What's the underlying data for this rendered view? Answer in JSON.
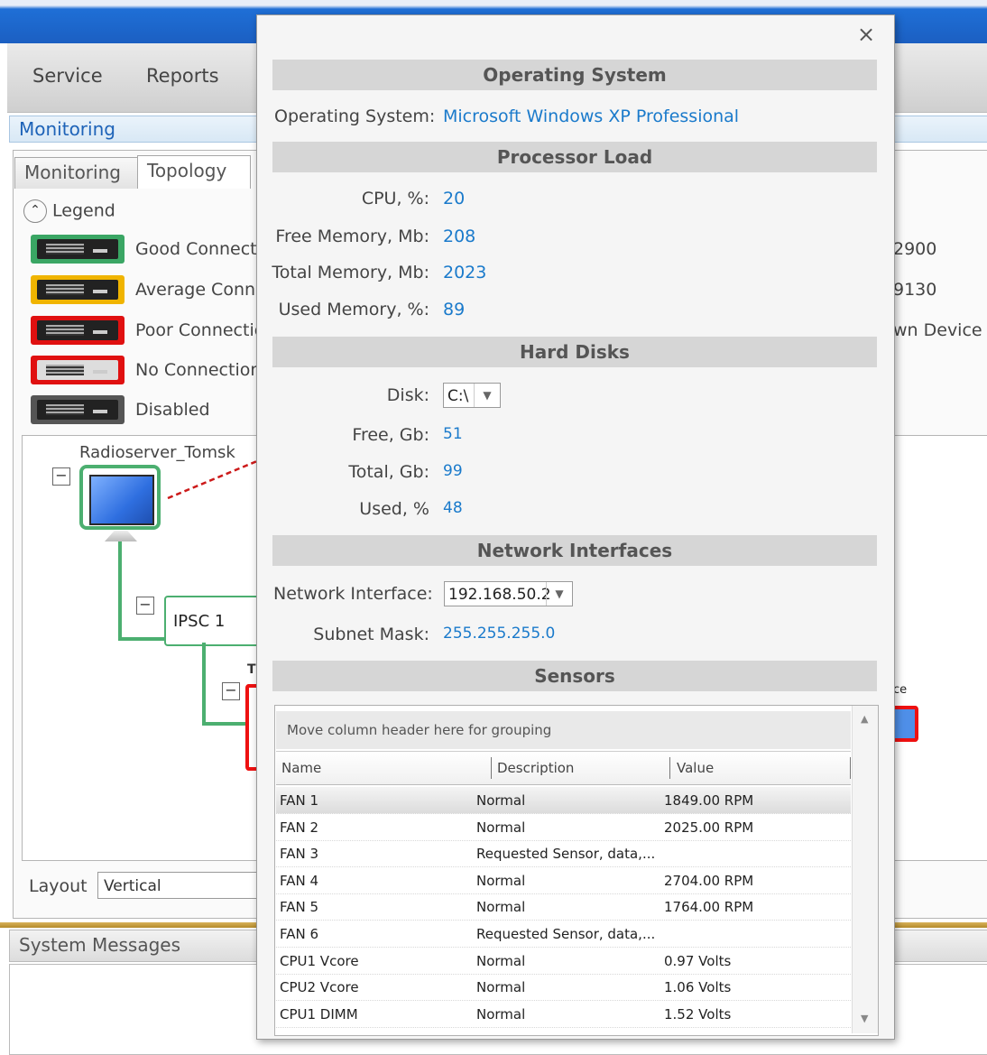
{
  "menu": {
    "items": [
      "Service",
      "Reports"
    ]
  },
  "monitoring_header": "Monitoring",
  "tabs": [
    "Monitoring",
    "Topology"
  ],
  "legend": {
    "title": "Legend",
    "items": [
      {
        "label": "Good Connecti",
        "color": "#3aa664"
      },
      {
        "label": "Average Conne",
        "color": "#f0b400"
      },
      {
        "label": "Poor Connectic",
        "color": "#e01010"
      },
      {
        "label": "No Connection",
        "color": "#e01010"
      },
      {
        "label": "Disabled",
        "color": "#555555"
      }
    ]
  },
  "right_side": {
    "line1": "2900",
    "line2": "9130",
    "line3": "wn Device",
    "tag": "ce"
  },
  "topology": {
    "server_label": "Radioserver_Tomsk",
    "ipsc_label": "IPSC 1",
    "sub_label": "T"
  },
  "layout": {
    "label": "Layout",
    "value": "Vertical"
  },
  "system_messages": "System Messages",
  "popup": {
    "close": "×",
    "os": {
      "title": "Operating System",
      "label": "Operating System:",
      "value": "Microsoft Windows XP Professional"
    },
    "processor": {
      "title": "Processor Load",
      "fields": [
        {
          "label": "CPU, %:",
          "value": "20"
        },
        {
          "label": "Free Memory, Mb:",
          "value": "208"
        },
        {
          "label": "Total Memory, Mb:",
          "value": "2023"
        },
        {
          "label": "Used Memory, %:",
          "value": "89"
        }
      ]
    },
    "disks": {
      "title": "Hard Disks",
      "disk_label": "Disk:",
      "disk_value": "C:\\",
      "fields": [
        {
          "label": "Free, Gb:",
          "value": "51"
        },
        {
          "label": "Total, Gb:",
          "value": "99"
        },
        {
          "label": "Used, %",
          "value": "48"
        }
      ]
    },
    "network": {
      "title": "Network Interfaces",
      "iface_label": "Network Interface:",
      "iface_value": "192.168.50.2",
      "mask_label": "Subnet Mask:",
      "mask_value": "255.255.255.0"
    },
    "sensors": {
      "title": "Sensors",
      "group_hint": "Move column header here for grouping",
      "columns": [
        "Name",
        "Description",
        "Value"
      ],
      "rows": [
        {
          "name": "FAN 1",
          "description": "Normal",
          "value": "1849.00 RPM"
        },
        {
          "name": "FAN 2",
          "description": "Normal",
          "value": "2025.00 RPM"
        },
        {
          "name": "FAN 3",
          "description": "Requested Sensor, data,...",
          "value": ""
        },
        {
          "name": "FAN 4",
          "description": "Normal",
          "value": "2704.00 RPM"
        },
        {
          "name": "FAN 5",
          "description": "Normal",
          "value": "1764.00 RPM"
        },
        {
          "name": "FAN 6",
          "description": "Requested Sensor, data,...",
          "value": ""
        },
        {
          "name": "CPU1 Vcore",
          "description": "Normal",
          "value": "0.97 Volts"
        },
        {
          "name": "CPU2 Vcore",
          "description": "Normal",
          "value": "1.06 Volts"
        },
        {
          "name": "CPU1 DIMM",
          "description": "Normal",
          "value": "1.52 Volts"
        }
      ]
    }
  }
}
